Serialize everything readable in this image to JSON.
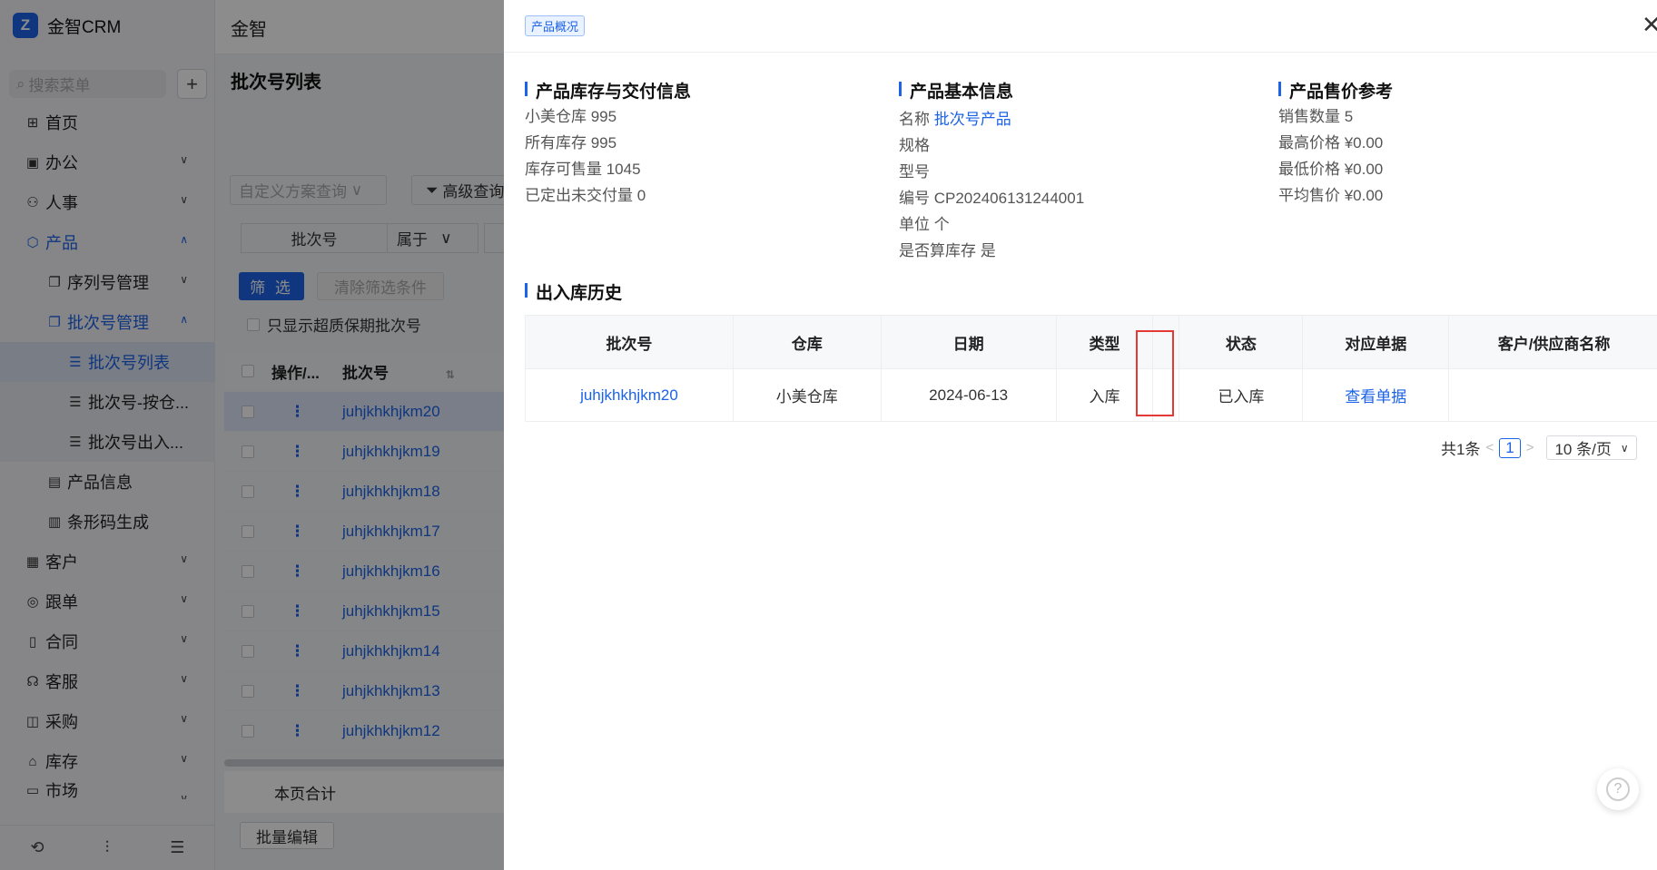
{
  "app": {
    "logo_text": "金智CRM",
    "topbar_title": "金智"
  },
  "sidebar": {
    "search_placeholder": "搜索菜单",
    "add_label": "+",
    "items": [
      {
        "label": "首页",
        "icon": "grid-icon"
      },
      {
        "label": "办公",
        "icon": "briefcase-icon"
      },
      {
        "label": "人事",
        "icon": "user-group-icon"
      },
      {
        "label": "产品",
        "icon": "cube-icon"
      },
      {
        "label": "序列号管理",
        "icon": "copy-icon"
      },
      {
        "label": "批次号管理",
        "icon": "copy-icon"
      },
      {
        "label": "批次号列表",
        "icon": "list-icon"
      },
      {
        "label": "批次号-按仓...",
        "icon": "list-icon"
      },
      {
        "label": "批次号出入...",
        "icon": "list-icon"
      },
      {
        "label": "产品信息",
        "icon": "document-icon"
      },
      {
        "label": "条形码生成",
        "icon": "barcode-icon"
      },
      {
        "label": "客户",
        "icon": "building-icon"
      },
      {
        "label": "跟单",
        "icon": "target-icon"
      },
      {
        "label": "合同",
        "icon": "contract-icon"
      },
      {
        "label": "客服",
        "icon": "headset-icon"
      },
      {
        "label": "采购",
        "icon": "bag-icon"
      },
      {
        "label": "库存",
        "icon": "warehouse-icon"
      },
      {
        "label": "市场",
        "icon": "chart-icon"
      }
    ]
  },
  "list_page": {
    "title": "批次号列表",
    "scheme_select_placeholder": "自定义方案查询",
    "advanced_query_label": "高级查询",
    "filter_field": "批次号",
    "filter_operator": "属于",
    "filter_button": "筛 选",
    "clear_button": "清除筛选条件",
    "only_expired_label": "只显示超质保期批次号",
    "columns": {
      "operation": "操作/...",
      "batch": "批次号"
    },
    "rows": [
      "juhjkhkhjkm20",
      "juhjkhkhjkm19",
      "juhjkhkhjkm18",
      "juhjkhkhjkm17",
      "juhjkhkhjkm16",
      "juhjkhkhjkm15",
      "juhjkhkhjkm14",
      "juhjkhkhjkm13",
      "juhjkhkhjkm12"
    ],
    "row_action_icon": "⋮",
    "page_total_label": "本页合计",
    "bulk_edit_label": "批量编辑"
  },
  "drawer": {
    "tag": "产品概况",
    "stock": {
      "title": "产品库存与交付信息",
      "lines": [
        "小美仓库  995",
        "所有库存  995",
        "库存可售量  1045",
        "已定出未交付量  0"
      ]
    },
    "basic": {
      "title": "产品基本信息",
      "name_label": "名称",
      "name_value": "批次号产品",
      "lines": [
        "规格",
        "型号",
        "编号 CP202406131244001",
        "单位 个",
        "是否算库存 是"
      ]
    },
    "price": {
      "title": "产品售价参考",
      "lines": [
        "销售数量 5",
        "最高价格 ¥0.00",
        "最低价格 ¥0.00",
        "平均售价 ¥0.00"
      ]
    },
    "history": {
      "title": "出入库历史",
      "columns": [
        "批次号",
        "仓库",
        "日期",
        "类型",
        "",
        "状态",
        "对应单据",
        "客户/供应商名称"
      ],
      "row": {
        "batch": "juhjkhkhjkm20",
        "warehouse": "小美仓库",
        "date": "2024-06-13",
        "type": "入库",
        "blank": "",
        "status": "已入库",
        "doc": "查看单据",
        "partner": ""
      }
    },
    "pager": {
      "total": "共1条",
      "current": "1",
      "size": "10 条/页"
    }
  }
}
